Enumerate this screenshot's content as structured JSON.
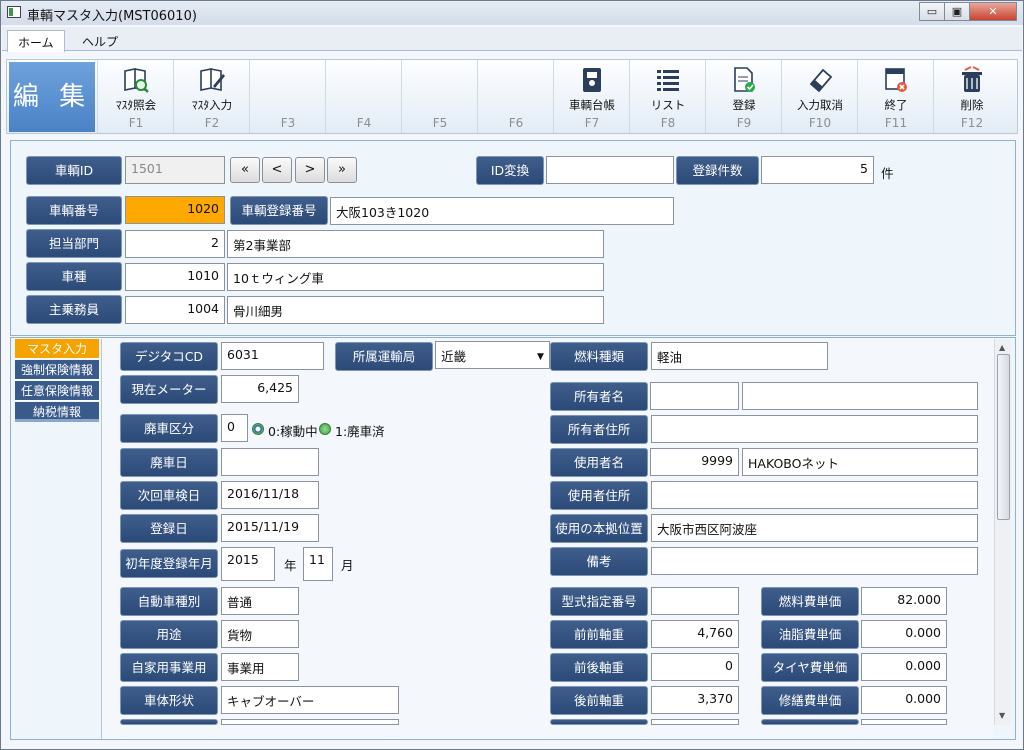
{
  "window": {
    "title": "車輌マスタ入力(MST06010)",
    "min": "▭",
    "max": "▣",
    "close": "✕"
  },
  "menu": {
    "tabs": [
      "ホーム",
      "ヘルプ"
    ]
  },
  "ribbon": {
    "edit_label": "編 集",
    "keys": [
      {
        "label": "ﾏｽﾀ照会",
        "key": "F1",
        "icon": "search-book-icon"
      },
      {
        "label": "ﾏｽﾀ入力",
        "key": "F2",
        "icon": "edit-book-icon"
      },
      {
        "label": "",
        "key": "F3"
      },
      {
        "label": "",
        "key": "F4"
      },
      {
        "label": "",
        "key": "F5"
      },
      {
        "label": "",
        "key": "F6"
      },
      {
        "label": "車輌台帳",
        "key": "F7",
        "icon": "ledger-icon"
      },
      {
        "label": "リスト",
        "key": "F8",
        "icon": "list-icon"
      },
      {
        "label": "登録",
        "key": "F9",
        "icon": "register-icon"
      },
      {
        "label": "入力取消",
        "key": "F10",
        "icon": "eraser-icon"
      },
      {
        "label": "終了",
        "key": "F11",
        "icon": "exit-icon"
      },
      {
        "label": "削除",
        "key": "F12",
        "icon": "trash-icon"
      }
    ]
  },
  "header": {
    "vehicle_id_label": "車輌ID",
    "vehicle_id": "1501",
    "nav": [
      "«",
      "<",
      ">",
      "»"
    ],
    "id_change_label": "ID変換",
    "id_change_value": "",
    "count_label": "登録件数",
    "count_value": "5",
    "count_unit": "件",
    "vehicle_no_label": "車輌番号",
    "vehicle_no": "1020",
    "reg_no_label": "車輌登録番号",
    "reg_no": "大阪103き1020",
    "dept_label": "担当部門",
    "dept_code": "2",
    "dept_name": "第2事業部",
    "type_label": "車種",
    "type_code": "1010",
    "type_name": "10ｔウィング車",
    "driver_label": "主乗務員",
    "driver_code": "1004",
    "driver_name": "骨川細男"
  },
  "sidenav": [
    "マスタ入力",
    "強制保険情報",
    "任意保険情報",
    "納税情報"
  ],
  "detail": {
    "digitaco_label": "デジタコCD",
    "digitaco": "6031",
    "bureau_label": "所属運輸局",
    "bureau": "近畿",
    "fuel_type_label": "燃料種類",
    "fuel_type": "軽油",
    "meter_label": "現在メーター",
    "meter": "6,425",
    "owner_label": "所有者名",
    "owner_code": "",
    "owner_name": "",
    "scrap_label": "廃車区分",
    "scrap_value": "0",
    "scrap_opt0": "0:稼動中",
    "scrap_opt1": "1:廃車済",
    "owner_addr_label": "所有者住所",
    "owner_addr": "",
    "scrap_date_label": "廃車日",
    "scrap_date": "",
    "user_label": "使用者名",
    "user_code": "9999",
    "user_name": "HAKOBOネット",
    "next_inspect_label": "次回車検日",
    "next_inspect": "2016/11/18",
    "user_addr_label": "使用者住所",
    "user_addr": "",
    "reg_date_label": "登録日",
    "reg_date": "2015/11/19",
    "base_label": "使用の本拠位置",
    "base": "大阪市西区阿波座",
    "first_reg_label": "初年度登録年月",
    "first_year": "2015",
    "year_unit": "年",
    "first_month": "11",
    "month_unit": "月",
    "note_label": "備考",
    "note": "",
    "car_kind_label": "自動車種別",
    "car_kind": "普通",
    "model_no_label": "型式指定番号",
    "model_no": "",
    "fuel_cost_label": "燃料費単価",
    "fuel_cost": "82.000",
    "usage_label": "用途",
    "usage": "貨物",
    "ff_axle_label": "前前軸重",
    "ff_axle": "4,760",
    "oil_cost_label": "油脂費単価",
    "oil_cost": "0.000",
    "private_label": "自家用事業用",
    "private": "事業用",
    "fr_axle_label": "前後軸重",
    "fr_axle": "0",
    "tire_cost_label": "タイヤ費単価",
    "tire_cost": "0.000",
    "body_label": "車体形状",
    "body": "キャブオーバー",
    "rf_axle_label": "後前軸重",
    "rf_axle": "3,370",
    "repair_cost_label": "修繕費単価",
    "repair_cost": "0.000"
  },
  "colors": {
    "label_bg": "#2c4a78",
    "highlight": "#ffa800",
    "ribbon_edit": "#5a8fd0"
  }
}
